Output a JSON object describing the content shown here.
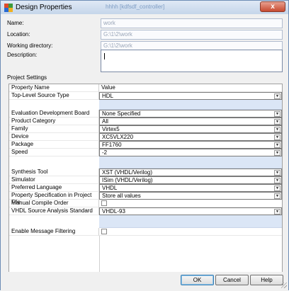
{
  "window": {
    "title": "Design Properties",
    "ghost_title": "hhhh [kdfsdf_controller]",
    "close_glyph": "x"
  },
  "fields": {
    "name_label": "Name:",
    "name_value": "work",
    "location_label": "Location:",
    "location_value": "G:\\1\\2\\work",
    "workdir_label": "Working directory:",
    "workdir_value": "G:\\1\\2\\work",
    "description_label": "Description:",
    "description_value": ""
  },
  "section": {
    "project_settings": "Project Settings"
  },
  "grid": {
    "header": {
      "property": "Property Name",
      "value": "Value"
    },
    "rows": [
      {
        "property": "Top-Level Source Type",
        "value": "HDL",
        "control": "dropdown"
      },
      {
        "property": "Evaluation Development Board",
        "value": "None Specified",
        "control": "dropdown"
      },
      {
        "property": "Product Category",
        "value": "All",
        "control": "dropdown"
      },
      {
        "property": "Family",
        "value": "Virtex5",
        "control": "dropdown"
      },
      {
        "property": "Device",
        "value": "XC5VLX220",
        "control": "dropdown"
      },
      {
        "property": "Package",
        "value": "FF1760",
        "control": "dropdown"
      },
      {
        "property": "Speed",
        "value": "-2",
        "control": "dropdown"
      },
      {
        "property": "Synthesis Tool",
        "value": "XST (VHDL/Verilog)",
        "control": "dropdown"
      },
      {
        "property": "Simulator",
        "value": "ISim (VHDL/Verilog)",
        "control": "dropdown"
      },
      {
        "property": "Preferred Language",
        "value": "VHDL",
        "control": "dropdown"
      },
      {
        "property": "Property Specification in Project File",
        "value": "Store all values",
        "control": "dropdown"
      },
      {
        "property": "Manual Compile Order",
        "value": "",
        "control": "checkbox",
        "checked": false
      },
      {
        "property": "VHDL Source Analysis Standard",
        "value": "VHDL-93",
        "control": "dropdown"
      },
      {
        "property": "Enable Message Filtering",
        "value": "",
        "control": "checkbox",
        "checked": false
      }
    ]
  },
  "buttons": {
    "ok": "OK",
    "cancel": "Cancel",
    "help": "Help"
  },
  "icons": {
    "dropdown": "chevron-down-icon",
    "app": "xilinx-app-icon"
  },
  "colors": {
    "accent": "#3c7fb1",
    "spacer_row": "#dbe6f6",
    "title_bar": "#c5d6ea"
  }
}
